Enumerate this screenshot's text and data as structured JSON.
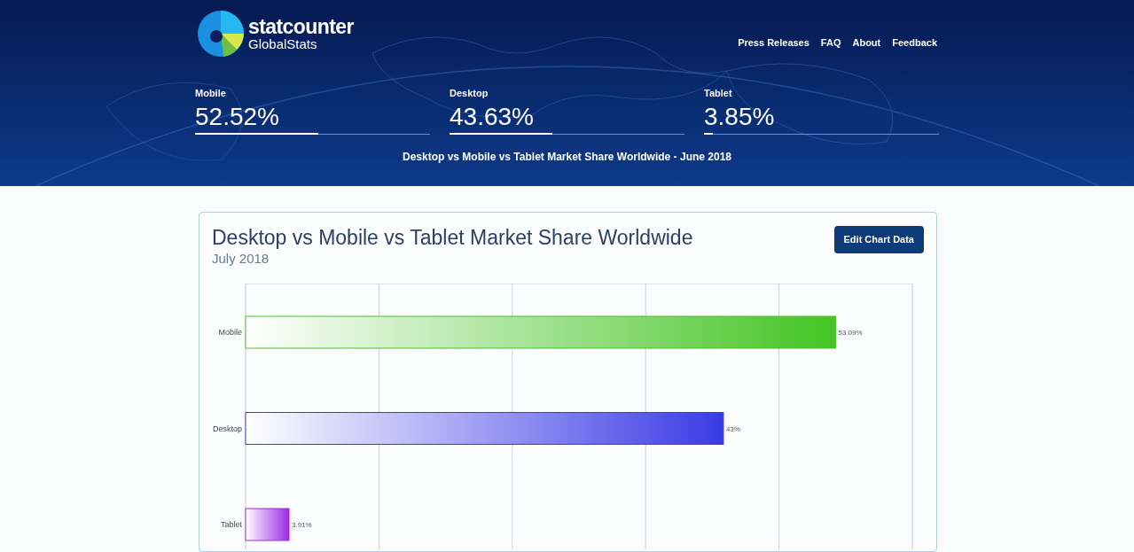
{
  "header": {
    "logo": {
      "name": "statcounter",
      "subtitle": "GlobalStats"
    },
    "nav": [
      "Press Releases",
      "FAQ",
      "About",
      "Feedback"
    ],
    "stats": [
      {
        "label": "Mobile",
        "value": "52.52%",
        "level": 0.5252
      },
      {
        "label": "Desktop",
        "value": "43.63%",
        "level": 0.4363
      },
      {
        "label": "Tablet",
        "value": "3.85%",
        "level": 0.0385
      }
    ],
    "caption": "Desktop vs Mobile vs Tablet Market Share Worldwide - June 2018"
  },
  "chart_card": {
    "title": "Desktop vs Mobile vs Tablet Market Share Worldwide",
    "subtitle": "July 2018",
    "button": "Edit Chart Data",
    "bars": [
      {
        "color": "#44c424"
      },
      {
        "color": "#3a3ae6"
      },
      {
        "color": "#9a2ae6"
      }
    ],
    "chart_data": {
      "type": "bar",
      "orientation": "horizontal",
      "categories": [
        "Mobile",
        "Desktop",
        "Tablet"
      ],
      "values": [
        53.09,
        43,
        3.91
      ],
      "value_labels": [
        "53.09%",
        "43%",
        "3.91%"
      ]
    }
  }
}
